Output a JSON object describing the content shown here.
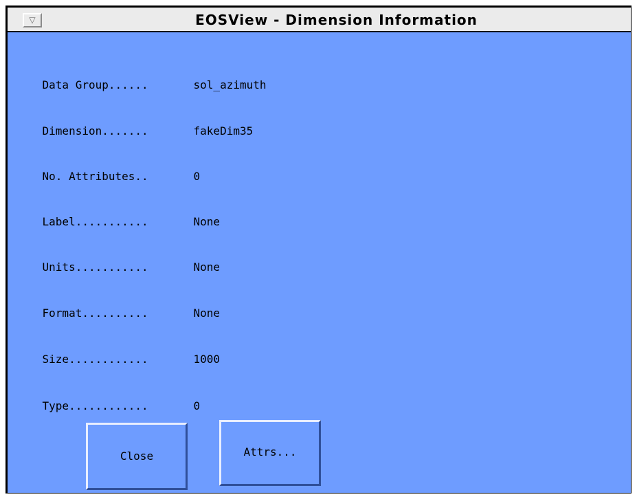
{
  "window": {
    "title": "EOSView - Dimension Information",
    "menu_icon": "triangle-down-icon"
  },
  "fields": [
    {
      "label": "Data Group......",
      "value": "sol_azimuth"
    },
    {
      "label": "Dimension.......",
      "value": "fakeDim35"
    },
    {
      "label": "No. Attributes..",
      "value": "0"
    },
    {
      "label": "Label...........",
      "value": "None"
    },
    {
      "label": "Units...........",
      "value": "None"
    },
    {
      "label": "Format..........",
      "value": "None"
    },
    {
      "label": "Size............",
      "value": "1000"
    },
    {
      "label": "Type............",
      "value": "0"
    }
  ],
  "buttons": {
    "close_label": "Close",
    "attrs_label": "Attrs..."
  },
  "colors": {
    "panel_background": "#6e9cff",
    "titlebar_background": "#ebebeb"
  }
}
